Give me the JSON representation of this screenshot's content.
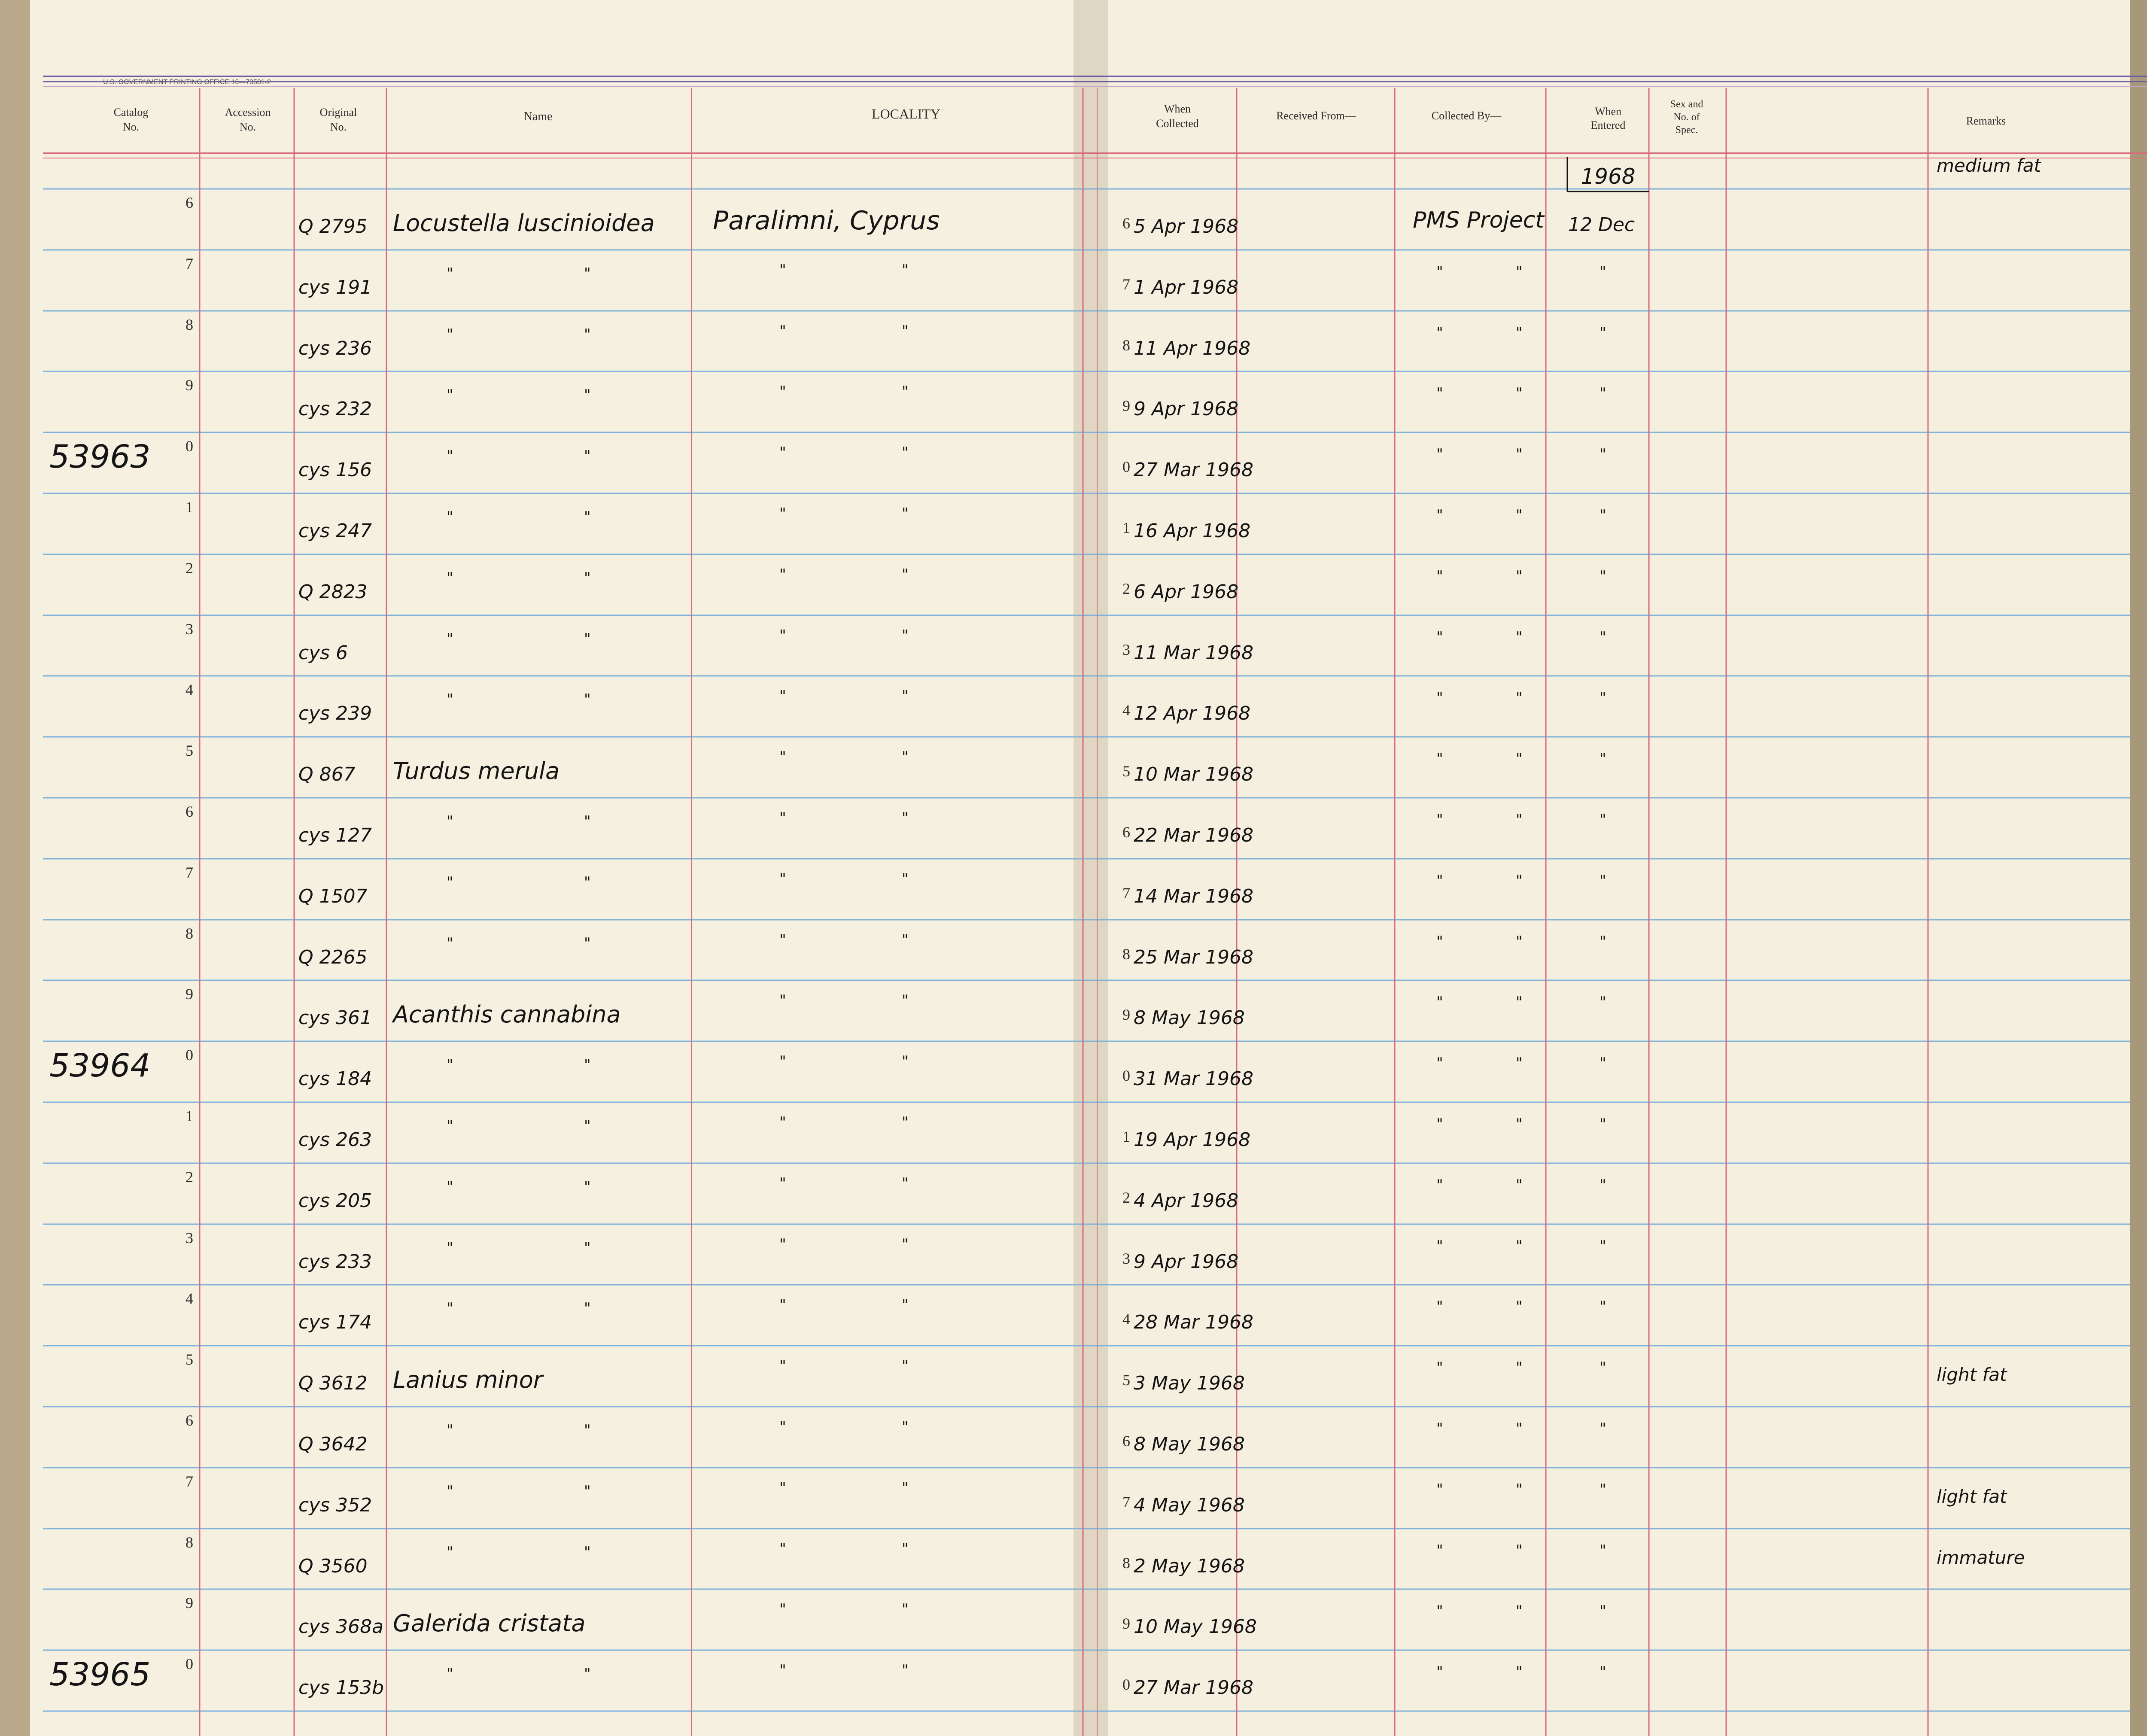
{
  "printer_line": "U.S. GOVERNMENT PRINTING OFFICE    16—73581-2",
  "headers": {
    "catalog": [
      "Catalog",
      "No."
    ],
    "accession": [
      "Accession",
      "No."
    ],
    "original": [
      "Original",
      "No."
    ],
    "name": [
      "Name"
    ],
    "locality": [
      "LOCALITY"
    ],
    "when_collected": [
      "When",
      "Collected"
    ],
    "received_from": [
      "Received From—"
    ],
    "collected_by": [
      "Collected By—"
    ],
    "when_entered": [
      "When",
      "Entered"
    ],
    "sex": [
      "Sex and",
      "No. of",
      "Spec."
    ],
    "remarks": [
      "Remarks"
    ]
  },
  "entered_year": "1968",
  "ditto_mark": "\"",
  "rows": [
    {
      "num": "6",
      "catalog": "",
      "original": "Q 2795",
      "name": "Locustella luscinioidea",
      "locality": "Paralimni, Cyprus",
      "date_num": "6",
      "date": "5 Apr 1968",
      "collector": "PMS Project",
      "entered": "12 Dec",
      "remarks": "medium fat"
    },
    {
      "num": "7",
      "catalog": "",
      "original": "cys 191",
      "name": "",
      "locality": "",
      "date_num": "7",
      "date": "1 Apr 1968",
      "collector": "",
      "entered": "",
      "remarks": ""
    },
    {
      "num": "8",
      "catalog": "",
      "original": "cys 236",
      "name": "",
      "locality": "",
      "date_num": "8",
      "date": "11 Apr 1968",
      "collector": "",
      "entered": "",
      "remarks": ""
    },
    {
      "num": "9",
      "catalog": "",
      "original": "cys 232",
      "name": "",
      "locality": "",
      "date_num": "9",
      "date": "9 Apr 1968",
      "collector": "",
      "entered": "",
      "remarks": ""
    },
    {
      "num": "0",
      "catalog": "53963",
      "original": "cys 156",
      "name": "",
      "locality": "",
      "date_num": "0",
      "date": "27 Mar 1968",
      "collector": "",
      "entered": "",
      "remarks": ""
    },
    {
      "num": "1",
      "catalog": "",
      "original": "cys 247",
      "name": "",
      "locality": "",
      "date_num": "1",
      "date": "16 Apr 1968",
      "collector": "",
      "entered": "",
      "remarks": ""
    },
    {
      "num": "2",
      "catalog": "",
      "original": "Q 2823",
      "name": "",
      "locality": "",
      "date_num": "2",
      "date": "6 Apr 1968",
      "collector": "",
      "entered": "",
      "remarks": ""
    },
    {
      "num": "3",
      "catalog": "",
      "original": "cys 6",
      "name": "",
      "locality": "",
      "date_num": "3",
      "date": "11 Mar 1968",
      "collector": "",
      "entered": "",
      "remarks": ""
    },
    {
      "num": "4",
      "catalog": "",
      "original": "cys 239",
      "name": "",
      "locality": "",
      "date_num": "4",
      "date": "12 Apr 1968",
      "collector": "",
      "entered": "",
      "remarks": ""
    },
    {
      "num": "5",
      "catalog": "",
      "original": "Q 867",
      "name": "Turdus merula",
      "locality": "",
      "date_num": "5",
      "date": "10 Mar 1968",
      "collector": "",
      "entered": "",
      "remarks": ""
    },
    {
      "num": "6",
      "catalog": "",
      "original": "cys 127",
      "name": "",
      "locality": "",
      "date_num": "6",
      "date": "22 Mar 1968",
      "collector": "",
      "entered": "",
      "remarks": ""
    },
    {
      "num": "7",
      "catalog": "",
      "original": "Q 1507",
      "name": "",
      "locality": "",
      "date_num": "7",
      "date": "14 Mar 1968",
      "collector": "",
      "entered": "",
      "remarks": ""
    },
    {
      "num": "8",
      "catalog": "",
      "original": "Q 2265",
      "name": "",
      "locality": "",
      "date_num": "8",
      "date": "25 Mar 1968",
      "collector": "",
      "entered": "",
      "remarks": ""
    },
    {
      "num": "9",
      "catalog": "",
      "original": "cys 361",
      "name": "Acanthis cannabina",
      "locality": "",
      "date_num": "9",
      "date": "8 May 1968",
      "collector": "",
      "entered": "",
      "remarks": ""
    },
    {
      "num": "0",
      "catalog": "53964",
      "original": "cys 184",
      "name": "",
      "locality": "",
      "date_num": "0",
      "date": "31 Mar 1968",
      "collector": "",
      "entered": "",
      "remarks": ""
    },
    {
      "num": "1",
      "catalog": "",
      "original": "cys 263",
      "name": "",
      "locality": "",
      "date_num": "1",
      "date": "19 Apr 1968",
      "collector": "",
      "entered": "",
      "remarks": ""
    },
    {
      "num": "2",
      "catalog": "",
      "original": "cys 205",
      "name": "",
      "locality": "",
      "date_num": "2",
      "date": "4 Apr 1968",
      "collector": "",
      "entered": "",
      "remarks": ""
    },
    {
      "num": "3",
      "catalog": "",
      "original": "cys 233",
      "name": "",
      "locality": "",
      "date_num": "3",
      "date": "9 Apr 1968",
      "collector": "",
      "entered": "",
      "remarks": ""
    },
    {
      "num": "4",
      "catalog": "",
      "original": "cys 174",
      "name": "",
      "locality": "",
      "date_num": "4",
      "date": "28 Mar 1968",
      "collector": "",
      "entered": "",
      "remarks": ""
    },
    {
      "num": "5",
      "catalog": "",
      "original": "Q 3612",
      "name": "Lanius minor",
      "locality": "",
      "date_num": "5",
      "date": "3 May 1968",
      "collector": "",
      "entered": "",
      "remarks": "light fat"
    },
    {
      "num": "6",
      "catalog": "",
      "original": "Q 3642",
      "name": "",
      "locality": "",
      "date_num": "6",
      "date": "8 May 1968",
      "collector": "",
      "entered": "",
      "remarks": ""
    },
    {
      "num": "7",
      "catalog": "",
      "original": "cys 352",
      "name": "",
      "locality": "",
      "date_num": "7",
      "date": "4 May 1968",
      "collector": "",
      "entered": "",
      "remarks": "light fat"
    },
    {
      "num": "8",
      "catalog": "",
      "original": "Q 3560",
      "name": "",
      "locality": "",
      "date_num": "8",
      "date": "2 May 1968",
      "collector": "",
      "entered": "",
      "remarks": "immature"
    },
    {
      "num": "9",
      "catalog": "",
      "original": "cys 368a",
      "name": "Galerida cristata",
      "locality": "",
      "date_num": "9",
      "date": "10 May 1968",
      "collector": "",
      "entered": "",
      "remarks": ""
    },
    {
      "num": "0",
      "catalog": "53965",
      "original": "cys 153b",
      "name": "",
      "locality": "",
      "date_num": "0",
      "date": "27 Mar 1968",
      "collector": "",
      "entered": "",
      "remarks": ""
    }
  ]
}
